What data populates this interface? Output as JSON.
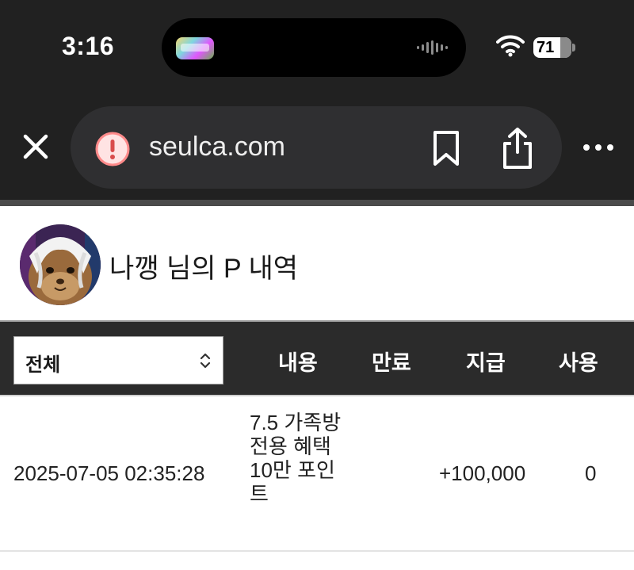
{
  "status_bar": {
    "time": "3:16",
    "battery": "71"
  },
  "browser": {
    "url": "seulca.com",
    "icons": [
      "close-icon",
      "warning-icon",
      "bookmark-icon",
      "share-icon",
      "more-icon",
      "wifi-icon",
      "battery-icon"
    ]
  },
  "profile": {
    "title": "나깽 님의 P 내역"
  },
  "table": {
    "filter_value": "전체",
    "headers": {
      "content": "내용",
      "expire": "만료",
      "pay": "지급",
      "use": "사용"
    },
    "rows": [
      {
        "date": "2025-07-05 02:35:28",
        "content_lines": [
          "7.5 가족방",
          "전용 혜택",
          "10만 포인",
          "트"
        ],
        "expire": "",
        "pay": "+100,000",
        "use": "0"
      }
    ]
  },
  "colors": {
    "chrome_bg": "#212121",
    "urlbar_bg": "#2f2f31",
    "table_header_bg": "#2b2b2b",
    "warning_accent": "#ff8a8a"
  }
}
